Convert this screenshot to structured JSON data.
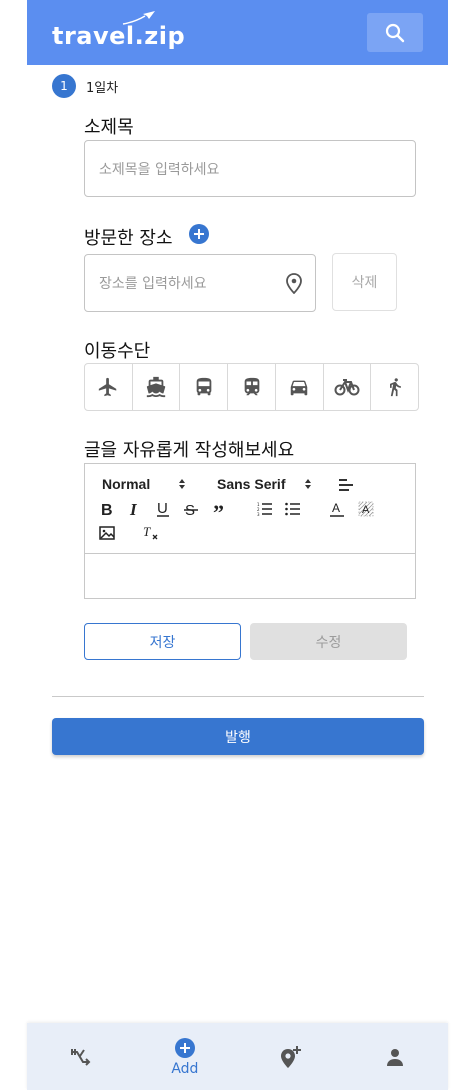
{
  "header": {
    "logo_text": "travel.zip",
    "search_icon": "search-icon"
  },
  "step": {
    "number": "1",
    "label": "1일차"
  },
  "subtitle": {
    "title": "소제목",
    "placeholder": "소제목을 입력하세요"
  },
  "places": {
    "title": "방문한 장소",
    "placeholder": "장소를 입력하세요",
    "delete_label": "삭제"
  },
  "transport": {
    "title": "이동수단",
    "options": [
      "airplane-icon",
      "ship-icon",
      "bus-icon",
      "train-icon",
      "car-icon",
      "bicycle-icon",
      "walk-icon"
    ]
  },
  "editor": {
    "title": "글을 자유롭게 작성해보세요",
    "size_select": "Normal",
    "font_select": "Sans Serif"
  },
  "actions": {
    "save_label": "저장",
    "edit_label": "수정",
    "publish_label": "발행"
  },
  "bottom_nav": {
    "add_label": "Add"
  },
  "colors": {
    "header": "#5b8ef0",
    "primary": "#3776d0"
  }
}
